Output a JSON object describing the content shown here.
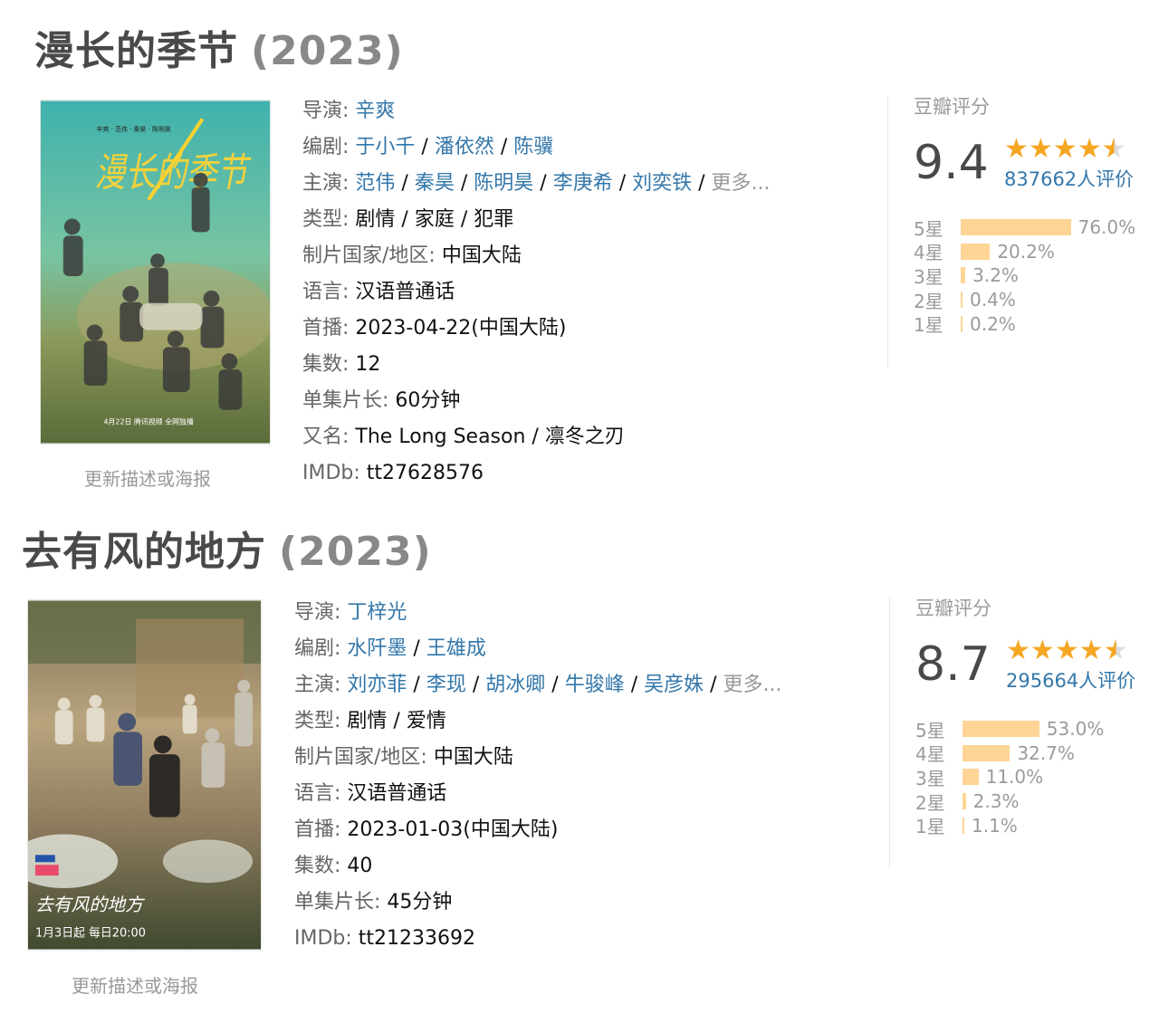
{
  "shows": [
    {
      "title": "漫长的季节",
      "year": "(2023)",
      "poster_text": {
        "top_names": "辛爽 · 范伟 · 秦昊 · 陈明昊",
        "title_art": "漫长的季节",
        "release": "4月22日 腾讯视频 全网独播"
      },
      "update_link": "更新描述或海报",
      "info": {
        "director": {
          "label": "导演",
          "values": [
            "辛爽"
          ]
        },
        "writers": {
          "label": "编剧",
          "values": [
            "于小千",
            "潘依然",
            "陈骥"
          ]
        },
        "cast": {
          "label": "主演",
          "values": [
            "范伟",
            "秦昊",
            "陈明昊",
            "李庚希",
            "刘奕铁"
          ],
          "more": "更多..."
        },
        "genre": {
          "label": "类型",
          "value": "剧情 / 家庭 / 犯罪"
        },
        "country": {
          "label": "制片国家/地区",
          "value": "中国大陆"
        },
        "language": {
          "label": "语言",
          "value": "汉语普通话"
        },
        "premiere": {
          "label": "首播",
          "value": "2023-04-22(中国大陆)"
        },
        "episodes": {
          "label": "集数",
          "value": "12"
        },
        "duration": {
          "label": "单集片长",
          "value": "60分钟"
        },
        "aka": {
          "label": "又名",
          "value": "The Long Season / 凛冬之刃"
        },
        "imdb": {
          "label": "IMDb",
          "value": "tt27628576"
        }
      },
      "rating": {
        "label": "豆瓣评分",
        "score": "9.4",
        "stars": 4.5,
        "votes": "837662人评价",
        "distribution": [
          {
            "label": "5星",
            "pct": "76.0%",
            "value": 76.0
          },
          {
            "label": "4星",
            "pct": "20.2%",
            "value": 20.2
          },
          {
            "label": "3星",
            "pct": "3.2%",
            "value": 3.2
          },
          {
            "label": "2星",
            "pct": "0.4%",
            "value": 0.4
          },
          {
            "label": "1星",
            "pct": "0.2%",
            "value": 0.2
          }
        ]
      }
    },
    {
      "title": "去有风的地方",
      "year": "(2023)",
      "poster_text": {
        "title_art": "去有风的地方",
        "release": "1月3日起 每日20:00"
      },
      "update_link": "更新描述或海报",
      "info": {
        "director": {
          "label": "导演",
          "values": [
            "丁梓光"
          ]
        },
        "writers": {
          "label": "编剧",
          "values": [
            "水阡墨",
            "王雄成"
          ]
        },
        "cast": {
          "label": "主演",
          "values": [
            "刘亦菲",
            "李现",
            "胡冰卿",
            "牛骏峰",
            "吴彦姝"
          ],
          "more": "更多..."
        },
        "genre": {
          "label": "类型",
          "value": "剧情 / 爱情"
        },
        "country": {
          "label": "制片国家/地区",
          "value": "中国大陆"
        },
        "language": {
          "label": "语言",
          "value": "汉语普通话"
        },
        "premiere": {
          "label": "首播",
          "value": "2023-01-03(中国大陆)"
        },
        "episodes": {
          "label": "集数",
          "value": "40"
        },
        "duration": {
          "label": "单集片长",
          "value": "45分钟"
        },
        "imdb": {
          "label": "IMDb",
          "value": "tt21233692"
        }
      },
      "rating": {
        "label": "豆瓣评分",
        "score": "8.7",
        "stars": 4.5,
        "votes": "295664人评价",
        "distribution": [
          {
            "label": "5星",
            "pct": "53.0%",
            "value": 53.0
          },
          {
            "label": "4星",
            "pct": "32.7%",
            "value": 32.7
          },
          {
            "label": "3星",
            "pct": "11.0%",
            "value": 11.0
          },
          {
            "label": "2星",
            "pct": "2.3%",
            "value": 2.3
          },
          {
            "label": "1星",
            "pct": "1.1%",
            "value": 1.1
          }
        ]
      }
    }
  ],
  "colors": {
    "link": "#3377aa",
    "label": "#666666",
    "star": "#f5a623",
    "bar": "#ffd596",
    "muted": "#999999"
  }
}
